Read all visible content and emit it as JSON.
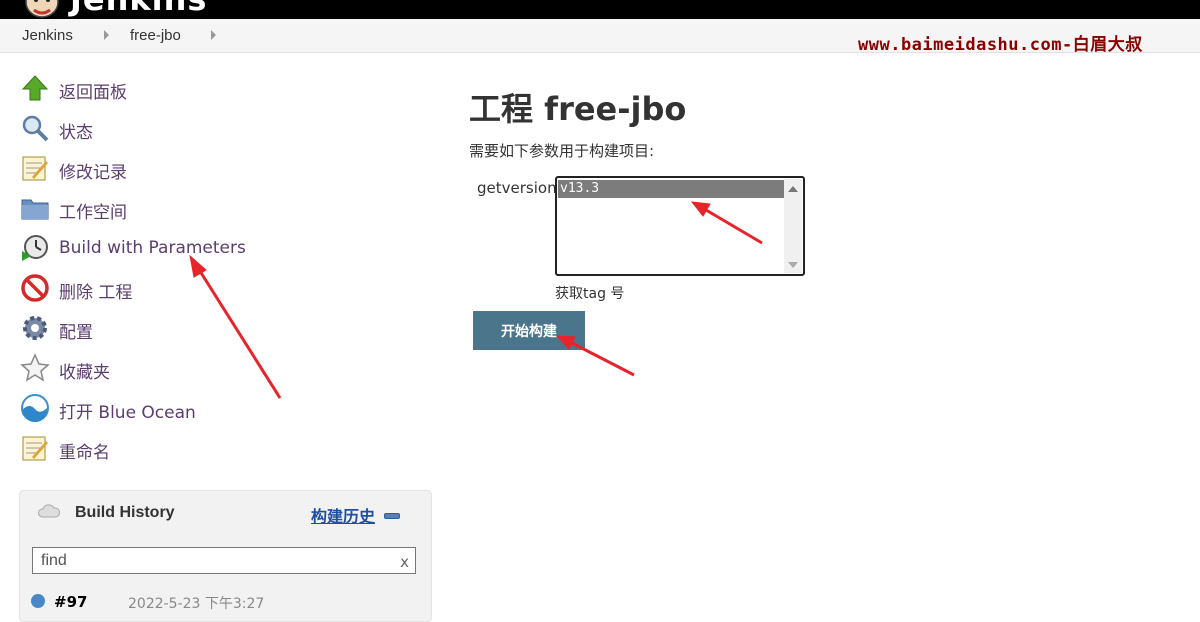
{
  "header": {
    "logo_text": "Jenkins"
  },
  "breadcrumb": {
    "items": [
      "Jenkins",
      "free-jbo"
    ]
  },
  "watermark": "www.baimeidashu.com-白眉大叔",
  "sidebar": {
    "tasks": [
      {
        "label": "返回面板",
        "icon": "up-arrow-icon"
      },
      {
        "label": "状态",
        "icon": "search-icon"
      },
      {
        "label": "修改记录",
        "icon": "notepad-icon"
      },
      {
        "label": "工作空间",
        "icon": "folder-icon"
      },
      {
        "label": "Build with Parameters",
        "icon": "clock-play-icon"
      },
      {
        "label": "删除 工程",
        "icon": "no-entry-icon"
      },
      {
        "label": "配置",
        "icon": "gear-icon"
      },
      {
        "label": "收藏夹",
        "icon": "star-icon"
      },
      {
        "label": "打开 Blue Ocean",
        "icon": "blue-ocean-icon"
      },
      {
        "label": "重命名",
        "icon": "notepad-icon"
      }
    ]
  },
  "build_history": {
    "title": "Build History",
    "link": "构建历史",
    "search_value": "find",
    "clear_label": "x",
    "first_build_number": "#97",
    "first_build_date": "2022-5-23 下午3:27"
  },
  "main": {
    "title": "工程 free-jbo",
    "description": "需要如下参数用于构建项目:",
    "param_name": "getversion",
    "param_options": [
      "v13.3"
    ],
    "param_help": "获取tag 号",
    "build_button": "开始构建"
  },
  "colors": {
    "header_bg": "#000000",
    "button_bg": "#4b758b",
    "link": "#5a3e6e",
    "watermark": "#8b0000"
  }
}
